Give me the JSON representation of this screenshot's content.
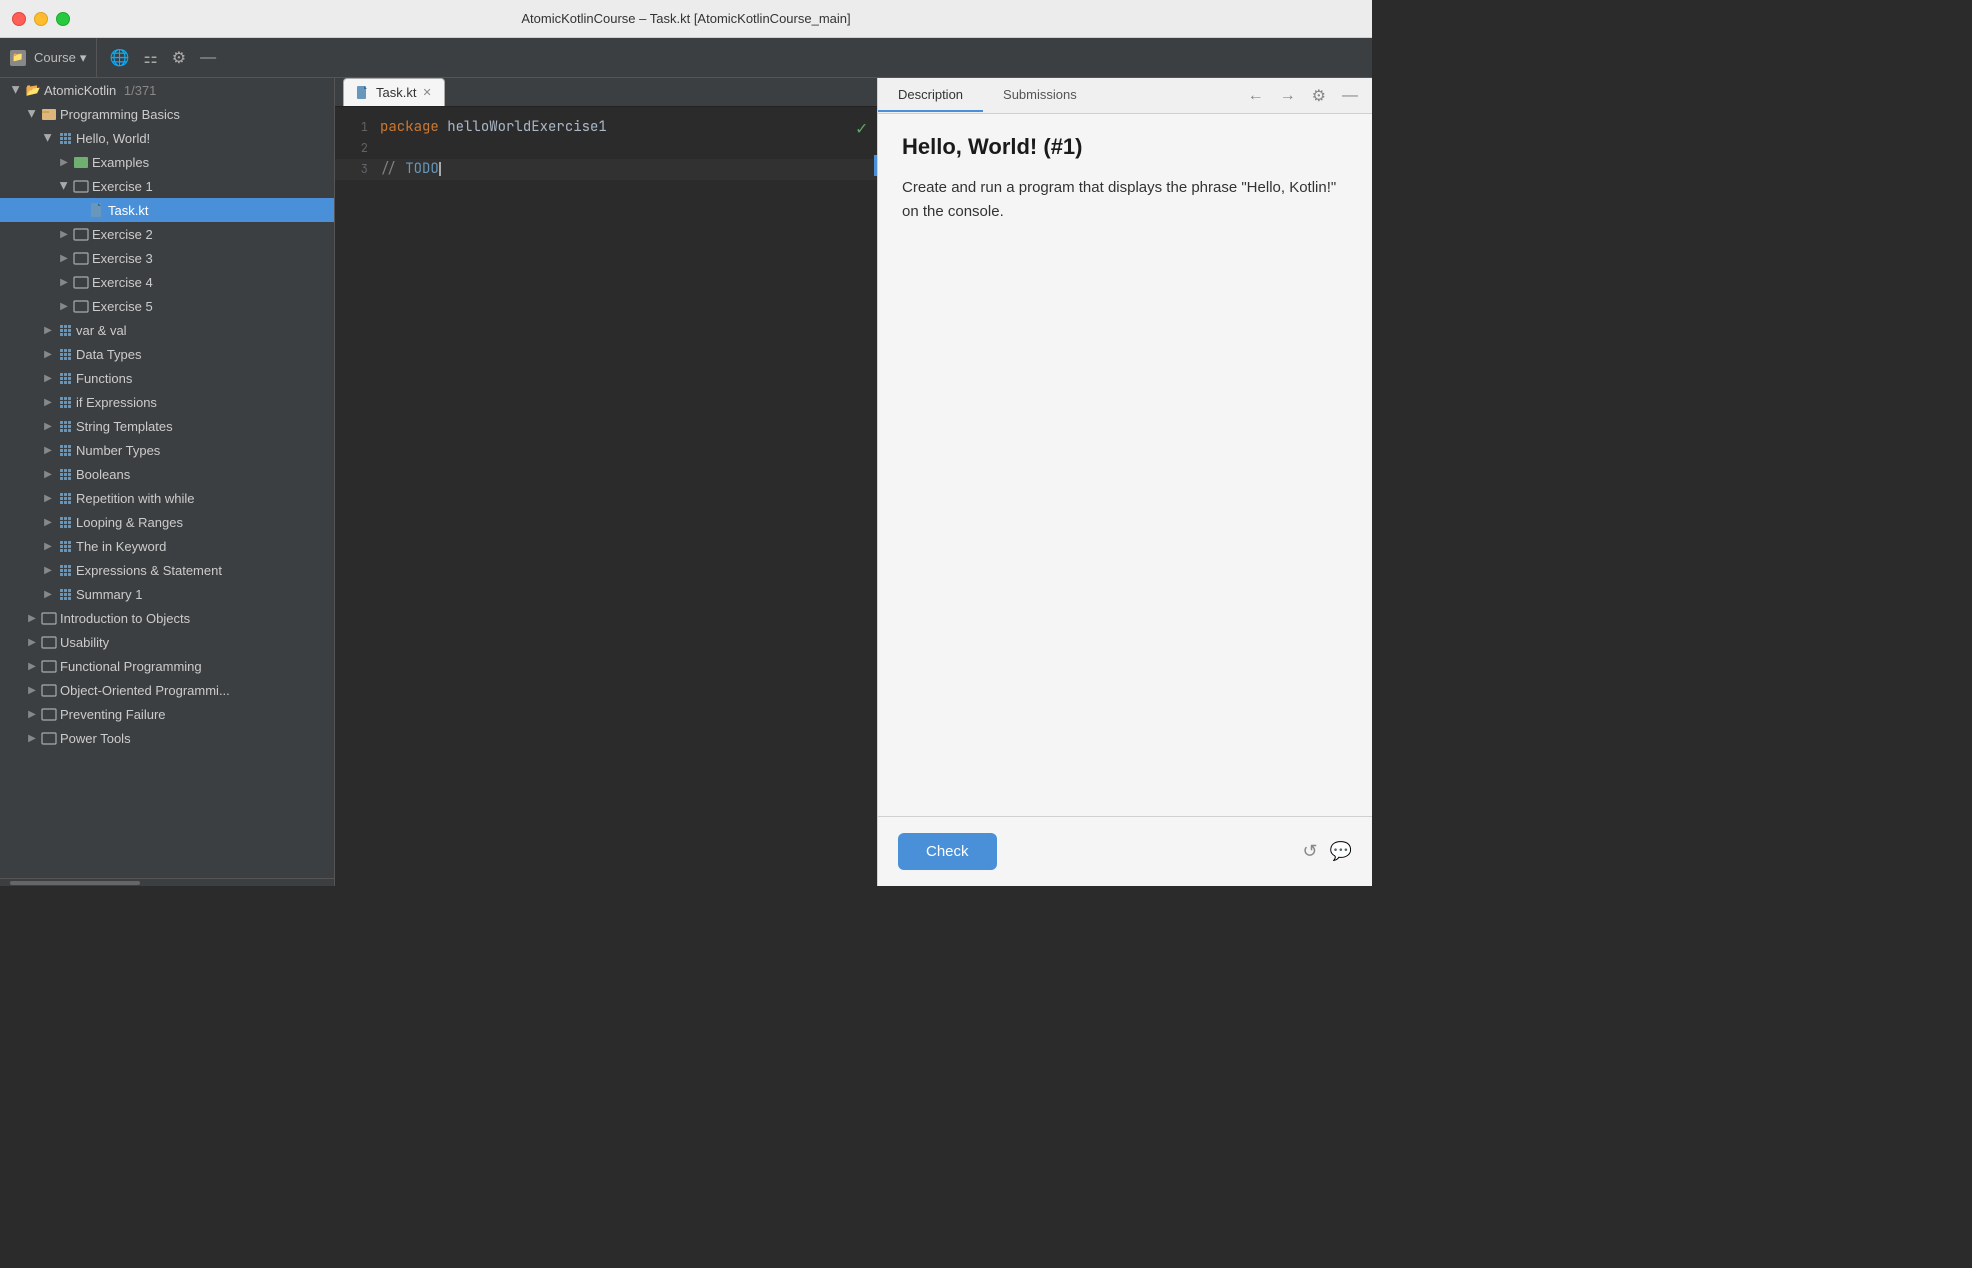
{
  "window": {
    "title": "AtomicKotlinCourse – Task.kt [AtomicKotlinCourse_main]"
  },
  "titlebar": {
    "buttons": {
      "close": "●",
      "minimize": "●",
      "maximize": "●"
    }
  },
  "toolbar": {
    "course_label": "Course",
    "dropdown_icon": "▾"
  },
  "tabs": [
    {
      "label": "Task.kt",
      "active": true,
      "closeable": true
    }
  ],
  "sidebar": {
    "root_label": "AtomicKotlin",
    "root_count": "1/371",
    "tree": [
      {
        "id": "programming-basics",
        "label": "Programming Basics",
        "level": 1,
        "type": "folder",
        "open": true
      },
      {
        "id": "hello-world",
        "label": "Hello, World!",
        "level": 2,
        "type": "module",
        "open": true
      },
      {
        "id": "examples",
        "label": "Examples",
        "level": 3,
        "type": "folder",
        "open": false
      },
      {
        "id": "exercise-1",
        "label": "Exercise 1",
        "level": 3,
        "type": "folder",
        "open": true
      },
      {
        "id": "task-kt",
        "label": "Task.kt",
        "level": 4,
        "type": "file",
        "selected": true
      },
      {
        "id": "exercise-2",
        "label": "Exercise 2",
        "level": 3,
        "type": "folder",
        "open": false
      },
      {
        "id": "exercise-3",
        "label": "Exercise 3",
        "level": 3,
        "type": "folder",
        "open": false
      },
      {
        "id": "exercise-4",
        "label": "Exercise 4",
        "level": 3,
        "type": "folder",
        "open": false
      },
      {
        "id": "exercise-5",
        "label": "Exercise 5",
        "level": 3,
        "type": "folder",
        "open": false
      },
      {
        "id": "var-val",
        "label": "var & val",
        "level": 2,
        "type": "module",
        "open": false
      },
      {
        "id": "data-types",
        "label": "Data Types",
        "level": 2,
        "type": "module",
        "open": false
      },
      {
        "id": "functions",
        "label": "Functions",
        "level": 2,
        "type": "module",
        "open": false
      },
      {
        "id": "if-expressions",
        "label": "if Expressions",
        "level": 2,
        "type": "module",
        "open": false
      },
      {
        "id": "string-templates",
        "label": "String Templates",
        "level": 2,
        "type": "module",
        "open": false
      },
      {
        "id": "number-types",
        "label": "Number Types",
        "level": 2,
        "type": "module",
        "open": false
      },
      {
        "id": "booleans",
        "label": "Booleans",
        "level": 2,
        "type": "module",
        "open": false
      },
      {
        "id": "repetition-while",
        "label": "Repetition with while",
        "level": 2,
        "type": "module",
        "open": false
      },
      {
        "id": "looping-ranges",
        "label": "Looping & Ranges",
        "level": 2,
        "type": "module",
        "open": false
      },
      {
        "id": "in-keyword",
        "label": "The in Keyword",
        "level": 2,
        "type": "module",
        "open": false
      },
      {
        "id": "expressions-stmt",
        "label": "Expressions & Statement",
        "level": 2,
        "type": "module",
        "open": false
      },
      {
        "id": "summary-1",
        "label": "Summary 1",
        "level": 2,
        "type": "module",
        "open": false
      },
      {
        "id": "intro-objects",
        "label": "Introduction to Objects",
        "level": 1,
        "type": "folder",
        "open": false
      },
      {
        "id": "usability",
        "label": "Usability",
        "level": 1,
        "type": "folder",
        "open": false
      },
      {
        "id": "functional-prog",
        "label": "Functional Programming",
        "level": 1,
        "type": "folder",
        "open": false
      },
      {
        "id": "oop",
        "label": "Object-Oriented Programmi...",
        "level": 1,
        "type": "folder",
        "open": false
      },
      {
        "id": "preventing-failure",
        "label": "Preventing Failure",
        "level": 1,
        "type": "folder",
        "open": false
      },
      {
        "id": "power-tools",
        "label": "Power Tools",
        "level": 1,
        "type": "folder",
        "open": false
      }
    ]
  },
  "editor": {
    "lines": [
      {
        "num": 1,
        "type": "package",
        "keyword": "package",
        "value": " helloWorldExercise1"
      },
      {
        "num": 2,
        "type": "empty"
      },
      {
        "num": 3,
        "type": "comment",
        "value": "// TODO"
      }
    ]
  },
  "right_panel": {
    "tabs": [
      {
        "label": "Description",
        "active": true
      },
      {
        "label": "Submissions",
        "active": false
      }
    ],
    "title": "Hello, World! (#1)",
    "description": "Create and run a program that displays the phrase \"Hello, Kotlin!\" on the console.",
    "check_button": "Check"
  }
}
